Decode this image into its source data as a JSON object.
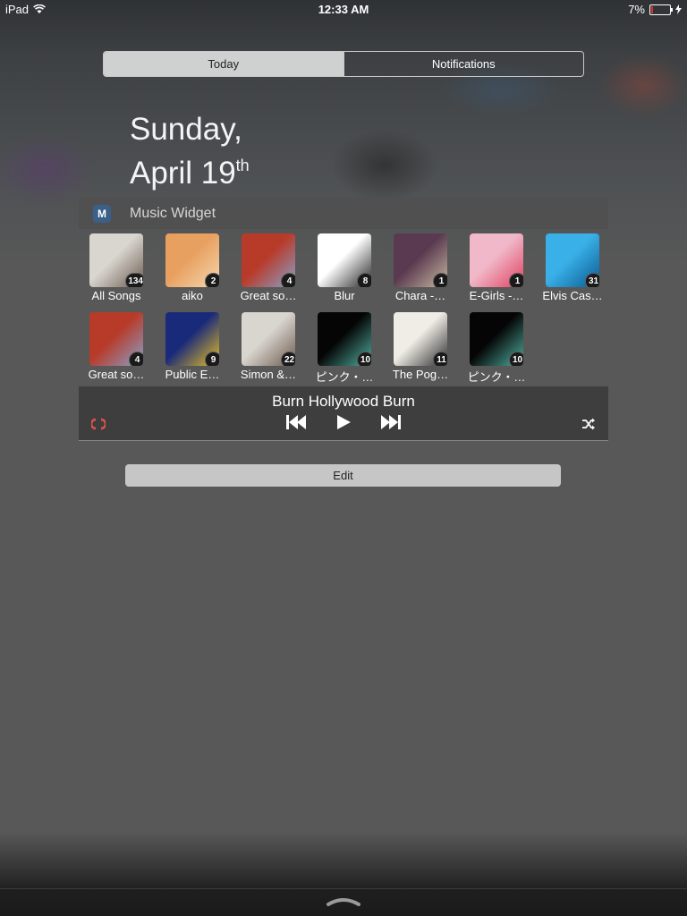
{
  "status_bar": {
    "device": "iPad",
    "time": "12:33 AM",
    "battery_text": "7%",
    "battery_level": 0.07,
    "wifi_icon": "wifi-icon",
    "charging_icon": "charging-bolt-icon"
  },
  "tabs": [
    {
      "label": "Today",
      "selected": true
    },
    {
      "label": "Notifications",
      "selected": false
    }
  ],
  "date": {
    "line1": "Sunday,",
    "line2": "April 19",
    "suffix": "th"
  },
  "widget": {
    "title": "Music Widget",
    "icon": "music-widget-app-icon",
    "icon_glyph": "M"
  },
  "albums": [
    {
      "label": "All Songs",
      "count": "134",
      "colors": [
        "#d9d6cf",
        "#6b5a4e"
      ]
    },
    {
      "label": "aiko",
      "count": "2",
      "colors": [
        "#e8a060",
        "#f4d8b0"
      ]
    },
    {
      "label": "Great so…",
      "count": "4",
      "colors": [
        "#b83a28",
        "#8aa0c8"
      ]
    },
    {
      "label": "Blur",
      "count": "8",
      "colors": [
        "#ffffff",
        "#222222"
      ]
    },
    {
      "label": "Chara -…",
      "count": "1",
      "colors": [
        "#5a3a50",
        "#c8b8a0"
      ]
    },
    {
      "label": "E-Girls -…",
      "count": "1",
      "colors": [
        "#f0b8c8",
        "#e04060"
      ]
    },
    {
      "label": "Elvis Cas…",
      "count": "31",
      "colors": [
        "#3ab0e8",
        "#0a5a90"
      ]
    },
    {
      "label": "Great so…",
      "count": "4",
      "colors": [
        "#b83a28",
        "#8aa0c8"
      ]
    },
    {
      "label": "Public E…",
      "count": "9",
      "colors": [
        "#1a2a7a",
        "#e8c020"
      ]
    },
    {
      "label": "Simon &…",
      "count": "22",
      "colors": [
        "#d9d6cf",
        "#6b5a4e"
      ]
    },
    {
      "label": "ピンク・…",
      "count": "10",
      "colors": [
        "#050505",
        "#4fb0a0"
      ]
    },
    {
      "label": "The Pog…",
      "count": "11",
      "colors": [
        "#f0ede6",
        "#2a2a2a"
      ]
    },
    {
      "label": "ピンク・…",
      "count": "10",
      "colors": [
        "#050505",
        "#4fb0a0"
      ]
    }
  ],
  "player": {
    "now_playing": "Burn Hollywood Burn",
    "repeat_color": "#e8504a"
  },
  "edit_label": "Edit"
}
